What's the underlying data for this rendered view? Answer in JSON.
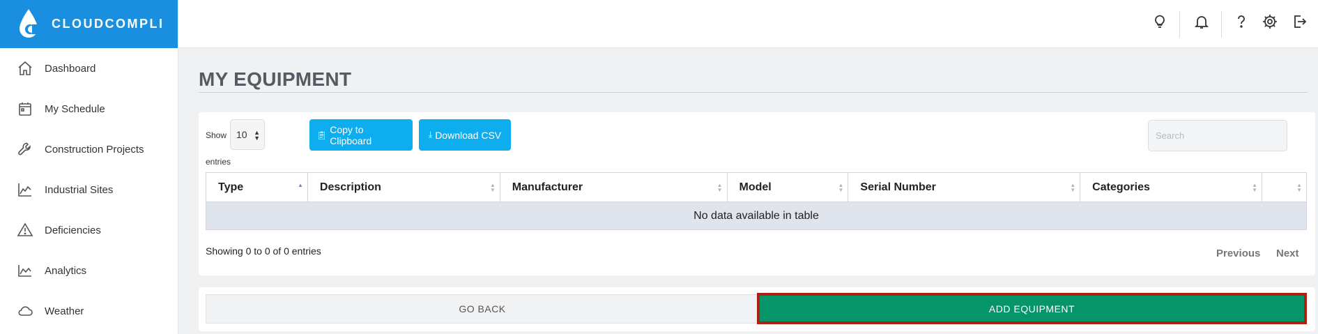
{
  "brand": {
    "name": "CLOUDCOMPLI",
    "color": "#1a8fe0"
  },
  "sidebar": {
    "items": [
      {
        "label": "Dashboard",
        "icon": "home-icon"
      },
      {
        "label": "My Schedule",
        "icon": "calendar-icon"
      },
      {
        "label": "Construction Projects",
        "icon": "wrench-icon"
      },
      {
        "label": "Industrial Sites",
        "icon": "factory-icon"
      },
      {
        "label": "Deficiencies",
        "icon": "warning-icon"
      },
      {
        "label": "Analytics",
        "icon": "area-chart-icon"
      },
      {
        "label": "Weather",
        "icon": "cloud-icon"
      }
    ]
  },
  "topbar": {
    "icons": [
      "lightbulb-icon",
      "bell-icon",
      "help-icon",
      "gear-icon",
      "logout-icon"
    ]
  },
  "page": {
    "title": "MY EQUIPMENT"
  },
  "table_controls": {
    "show_label": "Show",
    "page_size": "10",
    "entries_label": "entries",
    "copy_label": "Copy to Clipboard",
    "csv_label": "Download CSV",
    "search_placeholder": "Search"
  },
  "table": {
    "columns": [
      "Type",
      "Description",
      "Manufacturer",
      "Model",
      "Serial Number",
      "Categories",
      ""
    ],
    "empty_message": "No data available in table",
    "info": "Showing 0 to 0 of 0 entries",
    "previous_label": "Previous",
    "next_label": "Next"
  },
  "actions": {
    "back_label": "GO BACK",
    "add_label": "ADD EQUIPMENT",
    "add_color": "#069469",
    "accent_blue": "#0eadee"
  }
}
